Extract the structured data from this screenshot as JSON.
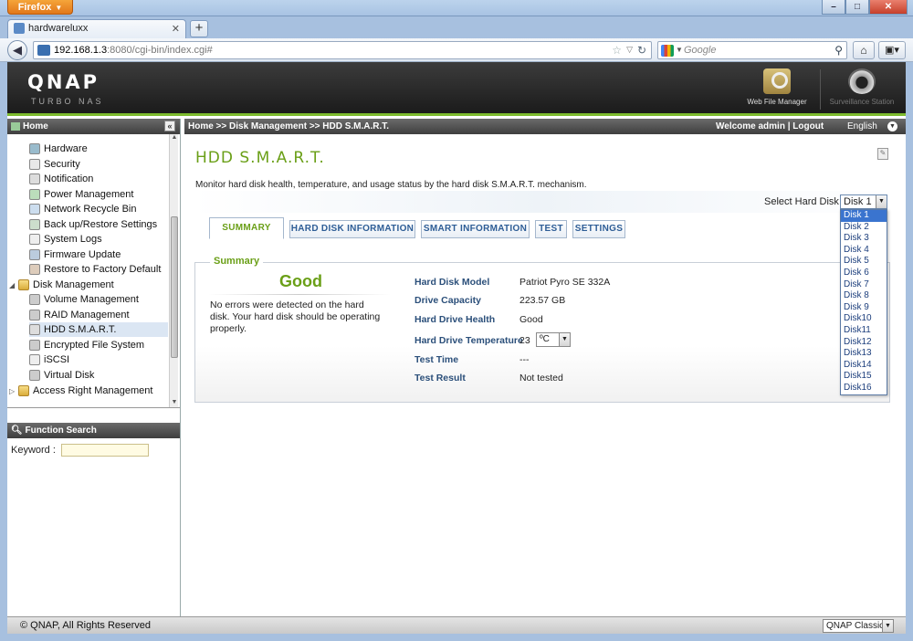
{
  "browser": {
    "menu_label": "Firefox",
    "tab_title": "hardwareluxx",
    "url_host": "192.168.1.3",
    "url_rest": ":8080/cgi-bin/index.cgi#",
    "search_placeholder": "Google"
  },
  "header": {
    "logo": "QNAP",
    "subtitle": "TURBO NAS",
    "apps": [
      {
        "label": "Web File Manager",
        "icon": "web-file-manager-icon"
      },
      {
        "label": "Surveillance Station",
        "icon": "surveillance-camera-icon"
      }
    ]
  },
  "sidebar": {
    "home_label": "Home",
    "items": [
      {
        "label": "Hardware",
        "icon": "hardware-icon"
      },
      {
        "label": "Security",
        "icon": "security-icon"
      },
      {
        "label": "Notification",
        "icon": "notification-icon"
      },
      {
        "label": "Power Management",
        "icon": "power-icon"
      },
      {
        "label": "Network Recycle Bin",
        "icon": "recycle-bin-icon"
      },
      {
        "label": "Back up/Restore Settings",
        "icon": "backup-icon"
      },
      {
        "label": "System Logs",
        "icon": "logs-icon"
      },
      {
        "label": "Firmware Update",
        "icon": "firmware-icon"
      },
      {
        "label": "Restore to Factory Default",
        "icon": "restore-icon"
      },
      {
        "label": "Disk Management",
        "icon": "folder-icon"
      },
      {
        "label": "Volume Management",
        "icon": "volume-icon"
      },
      {
        "label": "RAID Management",
        "icon": "raid-icon"
      },
      {
        "label": "HDD S.M.A.R.T.",
        "icon": "hdd-smart-icon"
      },
      {
        "label": "Encrypted File System",
        "icon": "encrypted-icon"
      },
      {
        "label": "iSCSI",
        "icon": "iscsi-icon"
      },
      {
        "label": "Virtual Disk",
        "icon": "virtual-disk-icon"
      },
      {
        "label": "Access Right Management",
        "icon": "folder-icon"
      }
    ],
    "function_search_label": "Function Search",
    "keyword_label": "Keyword :"
  },
  "topbar": {
    "breadcrumb": "Home >> Disk Management >> HDD S.M.A.R.T.",
    "welcome": "Welcome admin | Logout",
    "language": "English"
  },
  "main": {
    "title": "HDD S.M.A.R.T.",
    "description": "Monitor hard disk health, temperature, and usage status by the hard disk S.M.A.R.T. mechanism.",
    "select_label": "Select Hard Disk",
    "selected_disk": "Disk 1",
    "tabs": [
      "SUMMARY",
      "HARD DISK INFORMATION",
      "SMART INFORMATION",
      "TEST",
      "SETTINGS"
    ],
    "summary": {
      "legend": "Summary",
      "status": "Good",
      "message": "No errors were detected on the hard disk. Your hard disk should be operating properly.",
      "props": [
        {
          "key": "Hard Disk Model",
          "value": "Patriot Pyro SE 332A"
        },
        {
          "key": "Drive Capacity",
          "value": "223.57 GB"
        },
        {
          "key": "Hard Drive Health",
          "value": "Good"
        },
        {
          "key": "Hard Drive Temperature",
          "value": "23"
        },
        {
          "key": "Test Time",
          "value": "---"
        },
        {
          "key": "Test Result",
          "value": "Not tested"
        }
      ],
      "temp_unit": "ºC"
    },
    "disk_options": [
      "Disk 1",
      "Disk 2",
      "Disk 3",
      "Disk 4",
      "Disk 5",
      "Disk 6",
      "Disk 7",
      "Disk 8",
      "Disk 9",
      "Disk10",
      "Disk11",
      "Disk12",
      "Disk13",
      "Disk14",
      "Disk15",
      "Disk16"
    ]
  },
  "footer": {
    "copyright": "© QNAP, All Rights Reserved",
    "theme": "QNAP Classic"
  }
}
